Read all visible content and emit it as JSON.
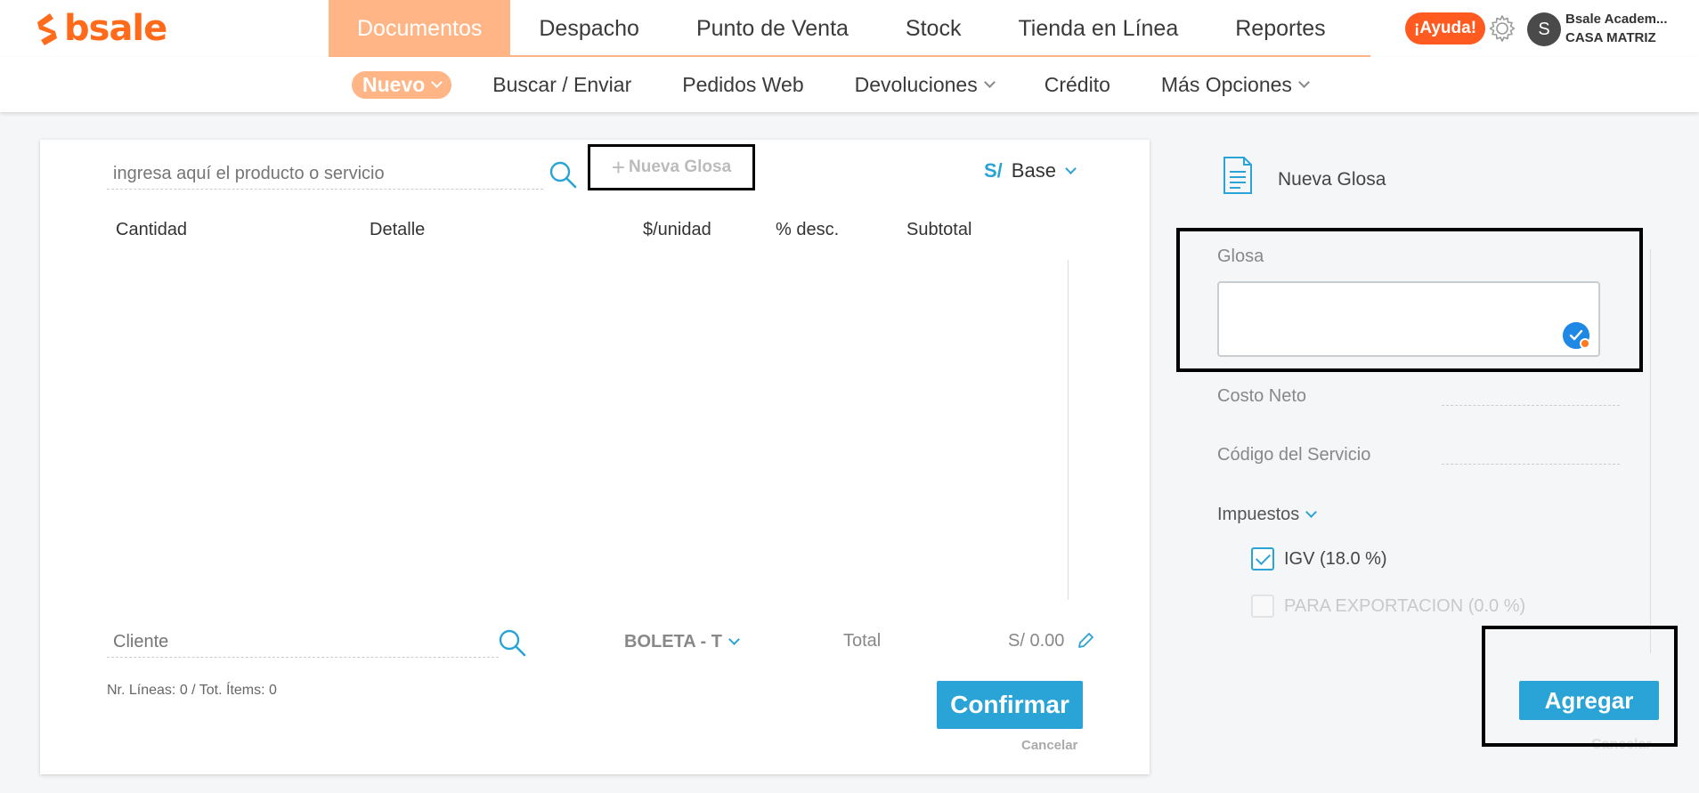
{
  "brand": {
    "name": "bsale",
    "color": "#ff6b1a"
  },
  "main_nav": [
    {
      "label": "Documentos",
      "active": true
    },
    {
      "label": "Despacho"
    },
    {
      "label": "Punto de Venta"
    },
    {
      "label": "Stock"
    },
    {
      "label": "Tienda en Línea"
    },
    {
      "label": "Reportes"
    }
  ],
  "header": {
    "help_label": "¡Ayuda!",
    "settings_icon": "gear-icon",
    "avatar_initial": "S",
    "user_name": "Bsale Academ...",
    "branch": "CASA MATRIZ"
  },
  "sub_nav": {
    "new_label": "Nuevo",
    "search_send": "Buscar / Enviar",
    "web_orders": "Pedidos Web",
    "returns": "Devoluciones",
    "credit": "Crédito",
    "more": "Más Opciones"
  },
  "document": {
    "product_search_placeholder": "ingresa aquí el producto o servicio",
    "new_gloss_label": "Nueva Glosa",
    "currency_symbol": "S/",
    "price_list": "Base",
    "columns": [
      "Cantidad",
      "Detalle",
      "$/unidad",
      "% desc.",
      "Subtotal"
    ],
    "client_placeholder": "Cliente",
    "doc_type": "BOLETA - T",
    "total_label": "Total",
    "total_value": "S/ 0.00",
    "lines_info": "Nr. Líneas: 0 / Tot. Ítems: 0",
    "confirm_label": "Confirmar",
    "cancel_label": "Cancelar"
  },
  "panel": {
    "title": "Nueva Glosa",
    "gloss_label": "Glosa",
    "gloss_value": "",
    "net_cost_label": "Costo Neto",
    "service_code_label": "Código del Servicio",
    "taxes_label": "Impuestos",
    "taxes": [
      {
        "label": "IGV (18.0 %)",
        "checked": true
      },
      {
        "label": "PARA EXPORTACION (0.0 %)",
        "checked": false
      }
    ],
    "add_label": "Agregar",
    "cancel_label": "Cancelar"
  },
  "colors": {
    "accent": "#2aa3d6",
    "brand_orange": "#ff6b1a",
    "active_nav": "#ffb585",
    "help_badge": "#ff5a1f"
  }
}
